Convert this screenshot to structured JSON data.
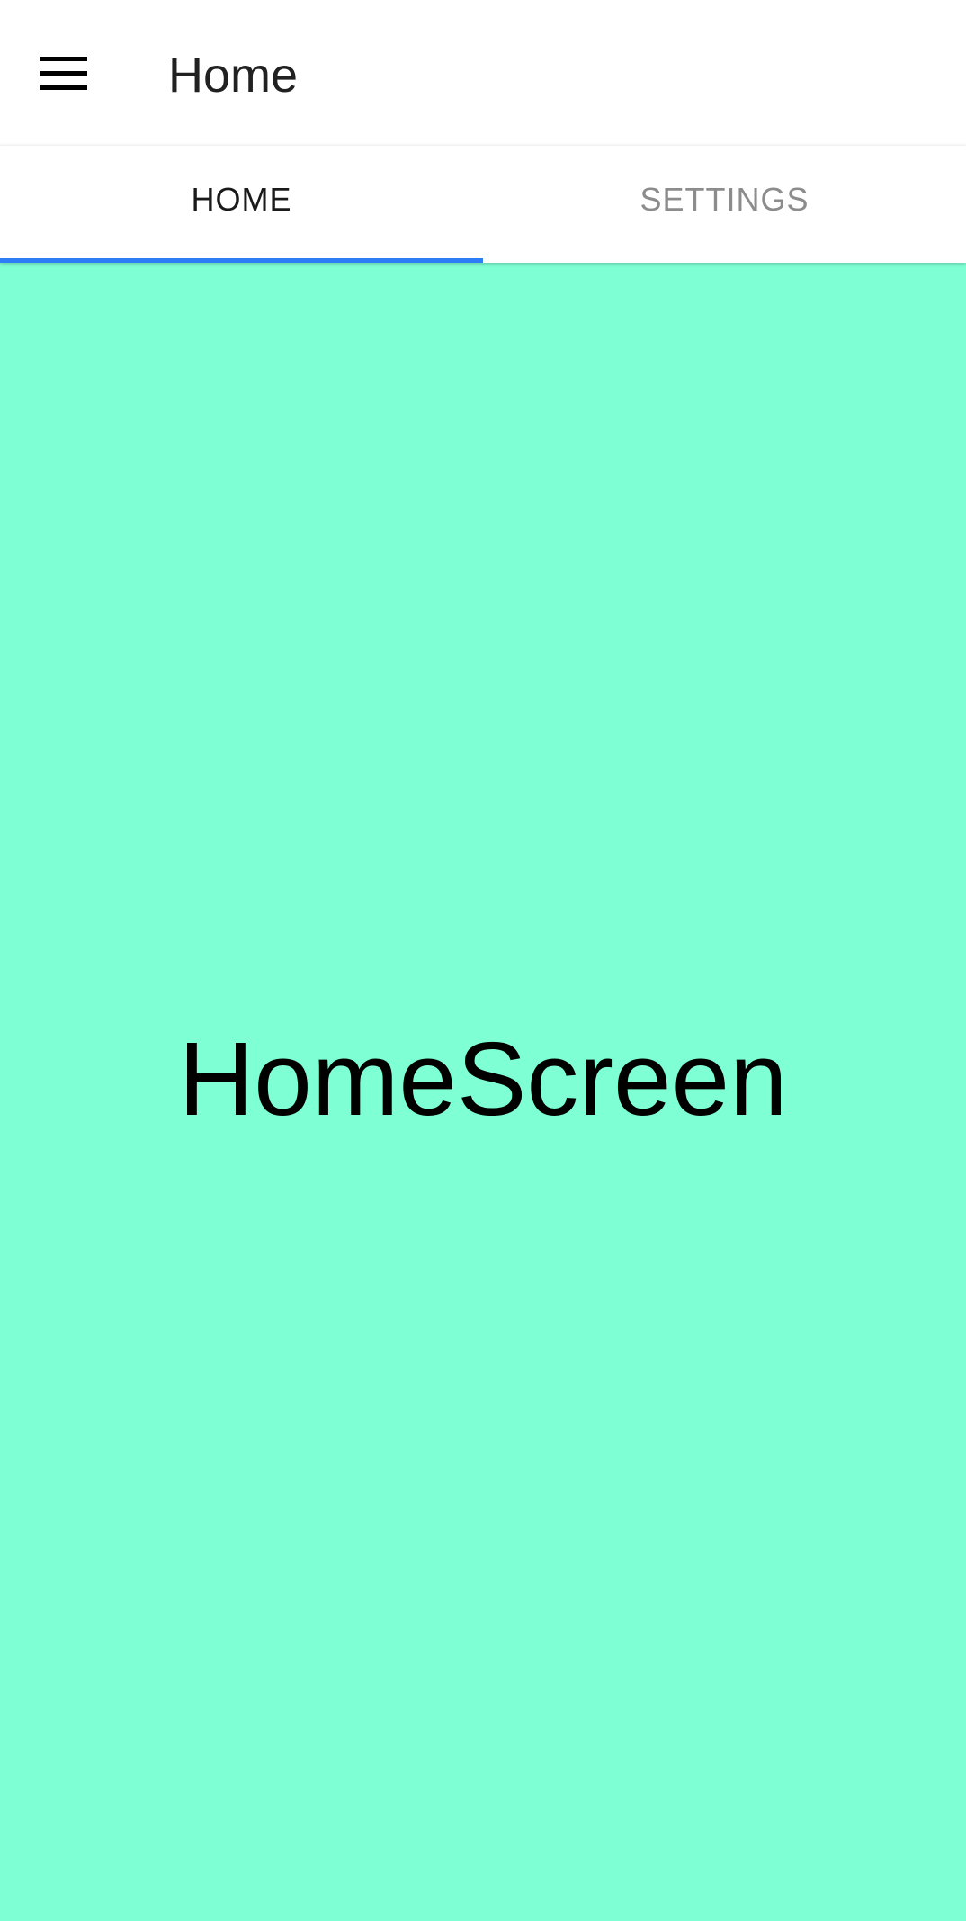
{
  "app_bar": {
    "title": "Home",
    "menu_icon": "hamburger-menu-icon"
  },
  "tabs": [
    {
      "label": "HOME",
      "active": true
    },
    {
      "label": "SETTINGS",
      "active": false
    }
  ],
  "content": {
    "text": "HomeScreen",
    "background_color": "#7fffd4"
  },
  "colors": {
    "tab_indicator": "#2e7cf6",
    "active_tab_text": "#1a1a1a",
    "inactive_tab_text": "#8c8c8c",
    "title_text": "#212121"
  }
}
